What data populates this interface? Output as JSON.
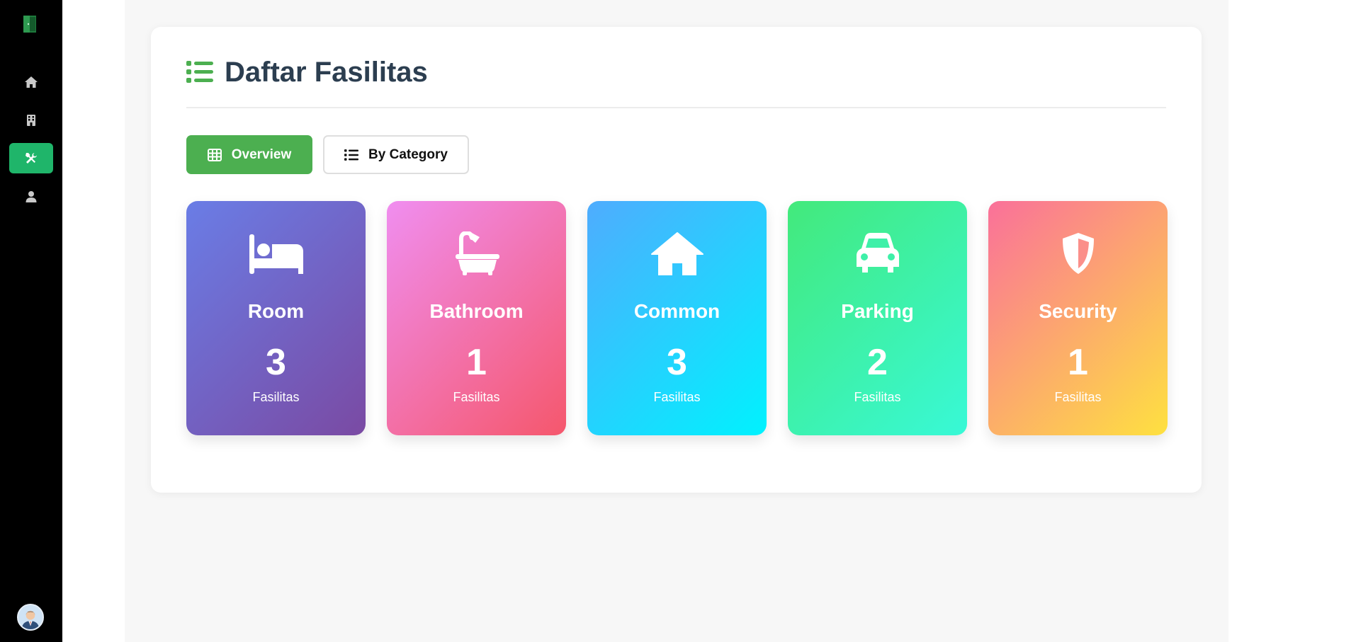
{
  "sidebar": {
    "logo_icon": "door-logo-icon",
    "items": [
      {
        "icon": "home-icon",
        "active": false
      },
      {
        "icon": "building-icon",
        "active": false
      },
      {
        "icon": "tools-icon",
        "active": true
      },
      {
        "icon": "user-icon",
        "active": false
      }
    ],
    "avatar_icon": "user-avatar"
  },
  "main": {
    "title": "Daftar Fasilitas",
    "title_icon": "list-icon",
    "accent_color": "#4caf50",
    "view_buttons": {
      "overview_label": "Overview",
      "overview_icon": "table-icon",
      "category_label": "By Category",
      "category_icon": "list-icon",
      "active": "overview"
    },
    "categories": [
      {
        "name": "Room",
        "count": "3",
        "unit": "Fasilitas",
        "icon": "bed-icon",
        "gradient": [
          "#6a7de6",
          "#7a4aa3"
        ]
      },
      {
        "name": "Bathroom",
        "count": "1",
        "unit": "Fasilitas",
        "icon": "bath-icon",
        "gradient": [
          "#f08ef0",
          "#f5576c"
        ]
      },
      {
        "name": "Common",
        "count": "3",
        "unit": "Fasilitas",
        "icon": "house-icon",
        "gradient": [
          "#4facfe",
          "#00f2fe"
        ]
      },
      {
        "name": "Parking",
        "count": "2",
        "unit": "Fasilitas",
        "icon": "car-icon",
        "gradient": [
          "#43e97b",
          "#38f9d7"
        ]
      },
      {
        "name": "Security",
        "count": "1",
        "unit": "Fasilitas",
        "icon": "shield-icon",
        "gradient": [
          "#fa709a",
          "#fee140"
        ]
      }
    ]
  }
}
